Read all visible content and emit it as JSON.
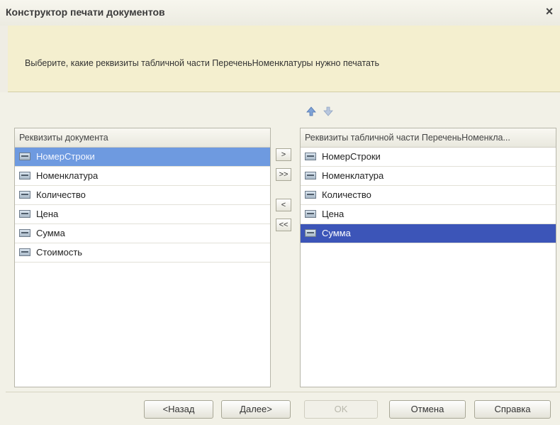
{
  "window": {
    "title": "Конструктор печати документов",
    "close_label": "×"
  },
  "banner": {
    "text": "Выберите, какие реквизиты табличной части ПереченьНоменклатуры нужно печатать"
  },
  "left_panel": {
    "header": "Реквизиты документа",
    "items": [
      {
        "label": "НомерСтроки",
        "selected": true
      },
      {
        "label": "Номенклатура"
      },
      {
        "label": "Количество"
      },
      {
        "label": "Цена"
      },
      {
        "label": "Сумма"
      },
      {
        "label": "Стоимость"
      }
    ]
  },
  "right_panel": {
    "header": "Реквизиты табличной части ПереченьНоменкла...",
    "items": [
      {
        "label": "НомерСтроки"
      },
      {
        "label": "Номенклатура"
      },
      {
        "label": "Количество"
      },
      {
        "label": "Цена"
      },
      {
        "label": "Сумма",
        "selected": true
      }
    ]
  },
  "move_buttons": {
    "add": ">",
    "add_all": ">>",
    "remove": "<",
    "remove_all": "<<"
  },
  "footer": {
    "back": "<Назад",
    "next": "Далее>",
    "ok": "OK",
    "cancel": "Отмена",
    "help": "Справка"
  },
  "colors": {
    "selection_left": "#6e9ae0",
    "selection_right": "#3c55b8",
    "banner_bg": "#f4efcf"
  }
}
